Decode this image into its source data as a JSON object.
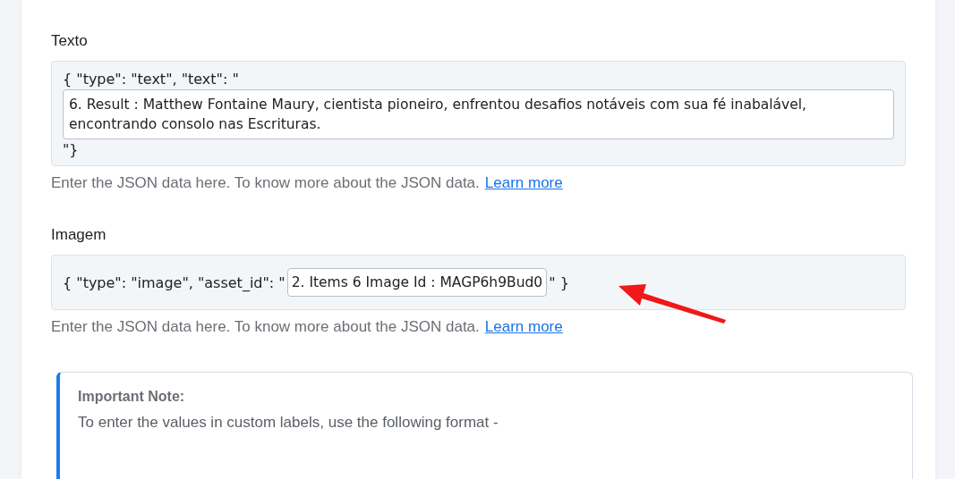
{
  "fields": [
    {
      "kind": "multiline",
      "label": "Texto",
      "prefix": "{ \"type\": \"text\", \"text\": \"",
      "value": "6. Result : Matthew Fontaine Maury, cientista pioneiro, enfrentou desafios notáveis com sua fé inabalável, encontrando consolo nas Escrituras.",
      "suffix": "\"}",
      "help": "Enter the JSON data here. To know more about the JSON data.",
      "link": "Learn more"
    },
    {
      "kind": "inline",
      "label": "Imagem",
      "prefix": "{ \"type\": \"image\", \"asset_id\": \"",
      "value": "2. Items 6 Image Id : MAGP6h9Bud0",
      "suffix": "\" }",
      "help": "Enter the JSON data here. To know more about the JSON data.",
      "link": "Learn more"
    }
  ],
  "note": {
    "title": "Important Note:",
    "text": "To enter the values in custom labels, use the following format -"
  }
}
